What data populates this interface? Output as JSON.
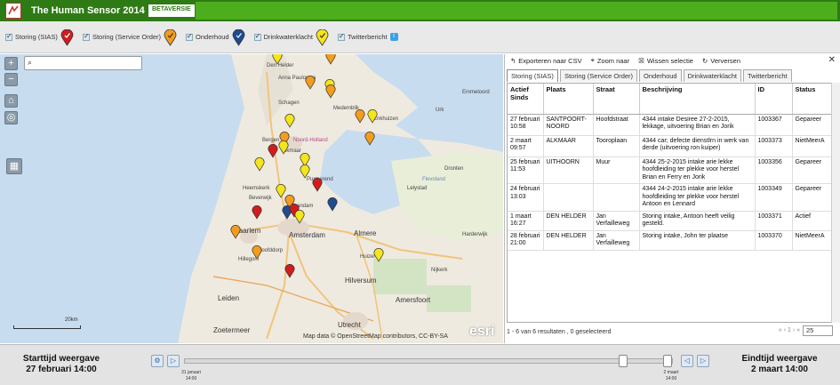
{
  "app": {
    "title": "The Human Sensor 2014",
    "badge": "BETAVERSIE"
  },
  "legend": [
    {
      "label": "Storing (SIAS)",
      "color": "#d01c1c"
    },
    {
      "label": "Storing (Service Order)",
      "color": "#f39c1d"
    },
    {
      "label": "Onderhoud",
      "color": "#1f4b8f"
    },
    {
      "label": "Drinkwaterklacht",
      "color": "#f4e51c"
    },
    {
      "label": "Twitterbericht",
      "color": "#3aa1e8"
    }
  ],
  "map": {
    "search_placeholder": "",
    "labels": [
      "Den Helder",
      "Anna Paulowna",
      "Schagen",
      "Medemblik",
      "Enkhuizen",
      "Bergen",
      "Alkmaar",
      "Noord-Holland",
      "Purmerend",
      "Heemskerk",
      "Beverwijk",
      "Zaandam",
      "Haarlem",
      "Amsterdam",
      "Almere",
      "Hillegom",
      "Hoofddorp",
      "Leiden",
      "Zoetermeer",
      "Utrecht",
      "Amersfoort",
      "Lelystad",
      "Dronten",
      "Huizen",
      "Hilversum",
      "Flevoland",
      "Emmeloord",
      "Urk",
      "Harderwijk",
      "Nijkerk"
    ],
    "scale": "20km",
    "attribution": "Map data © OpenStreetMap contributors, CC-BY-SA",
    "esri": "esri"
  },
  "panel": {
    "toolbar": [
      "Exporteren naar CSV",
      "Zoom naar",
      "Wissen selectie",
      "Verversen"
    ],
    "tabs": [
      "Storing (SIAS)",
      "Storing (Service Order)",
      "Onderhoud",
      "Drinkwaterklacht",
      "Twitterbericht"
    ],
    "columns": [
      "Actief Sinds",
      "Plaats",
      "Straat",
      "Beschrijving",
      "ID",
      "Status"
    ],
    "rows": [
      [
        "27 februari 10:58",
        "SANTPOORT-NOORD",
        "Hoofdstraat",
        "4344 intake Desiree 27-2-2015, lekkage, uitvoering Brian en Jorik",
        "1003367",
        "Gepareer"
      ],
      [
        "2 maart 09:57",
        "ALKMAAR",
        "Tooroplaan",
        "4344 car; defecte dienstlrn in werk van derde (uitvoering ron kuiper)",
        "1003373",
        "NietMeerA"
      ],
      [
        "25 februari 11:53",
        "UITHOORN",
        "Muur",
        "4344 25-2-2015 intake arie lekke hoofdleiding ter plekke voor herstel Brian en Ferry en Jorik",
        "1003356",
        "Gepareer"
      ],
      [
        "24 februari 13:03",
        "",
        "",
        "4344 24-2-2015 intake arie lekke hoofdleiding ter plekke voor herstel Antoon en Lennard",
        "1003349",
        "Gepareer"
      ],
      [
        "1 maart 16:27",
        "DEN HELDER",
        "Jan Verfailleweg",
        "Storing intake, Antoon heeft veilig gesteld.",
        "1003371",
        "Actief"
      ],
      [
        "28 februari 21:00",
        "DEN HELDER",
        "Jan Verfailleweg",
        "Storing intake, John ter plaatse",
        "1003370",
        "NietMeerA"
      ]
    ],
    "summary": "1 - 6 van 6 resultaten , 0 geselecteerd",
    "pager": "« ‹ 1 › »",
    "page_size": "25"
  },
  "timeline": {
    "start_label": "Starttijd weergave",
    "start_value": "27 februari 14:00",
    "end_label": "Eindtijd weergave",
    "end_value": "2 maart 14:00",
    "tick_left": "31 januari",
    "tick_left_time": "14:00",
    "tick_right": "2 maart",
    "tick_right_time": "14:00"
  }
}
